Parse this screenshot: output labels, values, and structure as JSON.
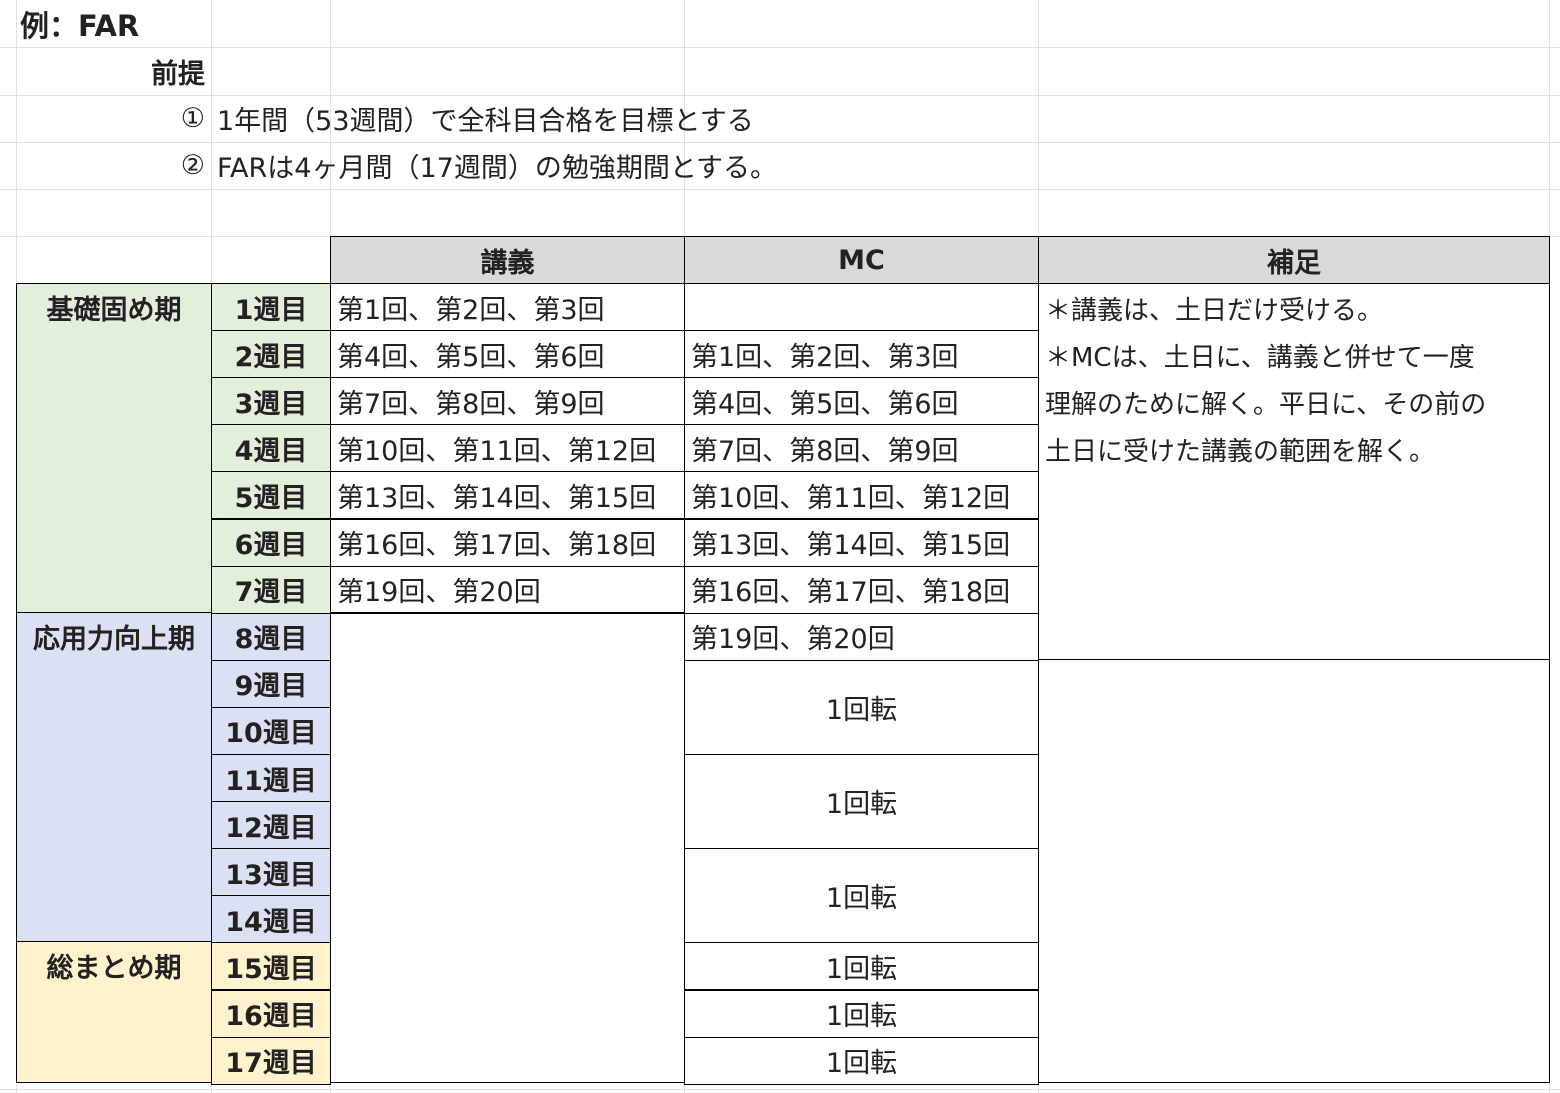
{
  "title": "例：FAR",
  "premise_label": "前提",
  "premises": [
    {
      "num": "①",
      "text": "1年間（53週間）で全科目合格を目標とする"
    },
    {
      "num": "②",
      "text": "FARは4ヶ月間（17週間）の勉強期間とする。"
    }
  ],
  "headers": {
    "lecture": "講義",
    "mc": "MC",
    "note": "補足"
  },
  "phases": [
    {
      "label": "基礎固め期",
      "color": "#e2efda"
    },
    {
      "label": "応用力向上期",
      "color": "#d9e1f2"
    },
    {
      "label": "総まとめ期",
      "color": "#fff2cc"
    }
  ],
  "weeks": [
    "1週目",
    "2週目",
    "3週目",
    "4週目",
    "5週目",
    "6週目",
    "7週目",
    "8週目",
    "9週目",
    "10週目",
    "11週目",
    "12週目",
    "13週目",
    "14週目",
    "15週目",
    "16週目",
    "17週目"
  ],
  "lectures": [
    "第1回、第2回、第3回",
    "第4回、第5回、第6回",
    "第7回、第8回、第9回",
    "第10回、第11回、第12回",
    "第13回、第14回、第15回",
    "第16回、第17回、第18回",
    "第19回、第20回"
  ],
  "mc": [
    "",
    "第1回、第2回、第3回",
    "第4回、第5回、第6回",
    "第7回、第8回、第9回",
    "第10回、第11回、第12回",
    "第13回、第14回、第15回",
    "第16回、第17回、第18回",
    "第19回、第20回"
  ],
  "rotations": [
    "1回転",
    "1回転",
    "1回転",
    "1回転",
    "1回転",
    "1回転"
  ],
  "note_lines": [
    "＊講義は、土日だけ受ける。",
    "＊MCは、土日に、講義と併せて一度",
    "理解のために解く。平日に、その前の",
    "土日に受けた講義の範囲を解く。"
  ]
}
